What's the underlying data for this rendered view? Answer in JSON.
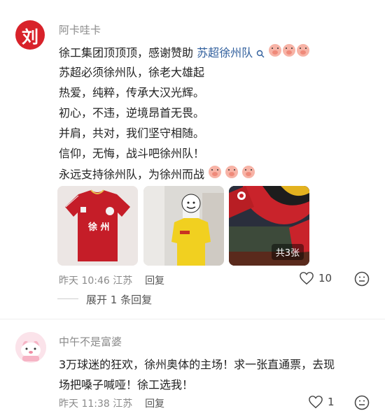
{
  "comment1": {
    "username": "阿卡哇卡",
    "avatar_text": "刘",
    "lines": [
      "徐工集团顶顶顶，感谢赞助",
      "苏超必须徐州队，徐老大雄起",
      "热爱，纯粹，传承大汉光辉。",
      "初心，不违，逆境昂首无畏。",
      "并肩，共对，我们坚守相随。",
      "信仰，无悔，战斗吧徐州队！",
      "永远支持徐州队，为徐州而战"
    ],
    "topic_tag": "苏超徐州队",
    "images": [
      {
        "desc": "red jersey",
        "jersey_text": "徐 州"
      },
      {
        "desc": "yellow jersey person"
      },
      {
        "desc": "stadium flags",
        "badge": "共3张"
      }
    ],
    "time": "昨天 10:46",
    "location": "江苏",
    "reply_label": "回复",
    "like_count": "10",
    "expand_text": "展开 1 条回复"
  },
  "comment2": {
    "username": "中午不是富婆",
    "lines": [
      "3万球迷的狂欢，徐州奥体的主场！求一张直通票，去现",
      "场把嗓子喊哑！徐工选我！"
    ],
    "time": "昨天 11:38",
    "location": "江苏",
    "reply_label": "回复",
    "like_count": "1"
  },
  "colors": {
    "accent_link": "#2f5e9c",
    "avatar_red": "#d8222a",
    "meta_gray": "#8a8a8a"
  }
}
